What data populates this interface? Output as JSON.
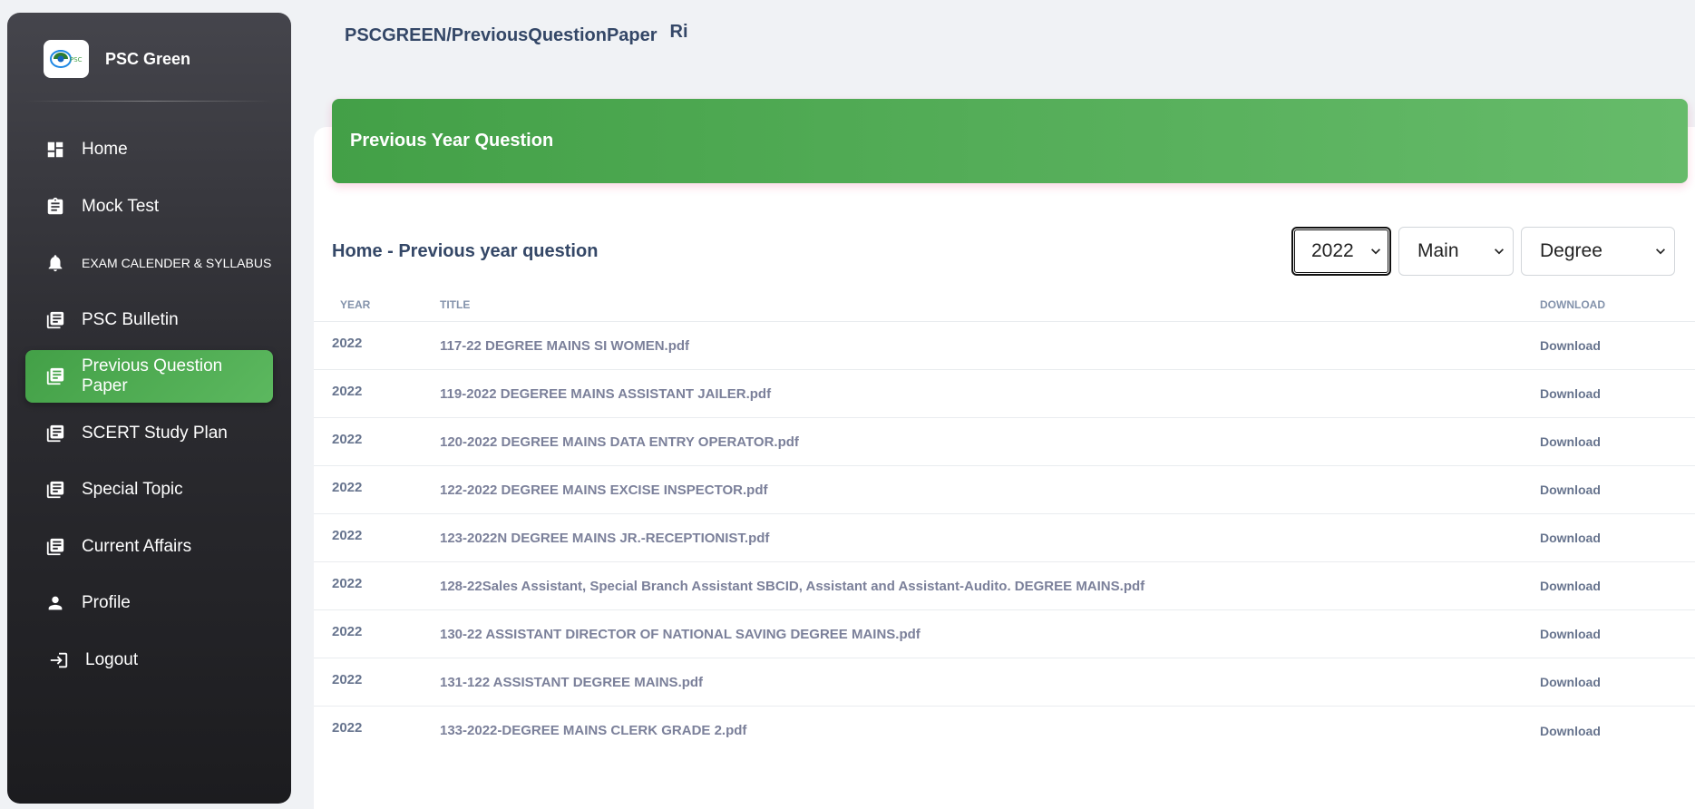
{
  "sidebar": {
    "brand_name": "PSC Green",
    "logo_text": "PSC",
    "items": [
      {
        "label": "Home",
        "icon": "dashboard-icon",
        "active": false
      },
      {
        "label": "Mock Test",
        "icon": "clipboard-icon",
        "active": false
      },
      {
        "label": "EXAM CALENDER & SYLLABUS",
        "icon": "bell-icon",
        "active": false
      },
      {
        "label": "PSC Bulletin",
        "icon": "library-icon",
        "active": false
      },
      {
        "label": "Previous Question Paper",
        "icon": "library-icon",
        "active": true
      },
      {
        "label": "SCERT Study Plan",
        "icon": "library-icon",
        "active": false
      },
      {
        "label": "Special Topic",
        "icon": "library-icon",
        "active": false
      },
      {
        "label": "Current Affairs",
        "icon": "library-icon",
        "active": false
      },
      {
        "label": "Profile",
        "icon": "person-icon",
        "active": false
      },
      {
        "label": "Logout",
        "icon": "login-icon",
        "active": false
      }
    ]
  },
  "header": {
    "breadcrumb": "PSCGREEN/PreviousQuestionPaper",
    "user_initials": "Ri"
  },
  "banner": {
    "title": "Previous Year Question"
  },
  "main": {
    "section_title": "Home - Previous year question",
    "filters": {
      "year": "2022",
      "exam_type": "Main",
      "qualification": "Degree"
    },
    "table": {
      "headers": {
        "year": "YEAR",
        "title": "TITLE",
        "download": "DOWNLOAD"
      },
      "rows": [
        {
          "year": "2022",
          "title": "117-22 DEGREE MAINS SI WOMEN.pdf",
          "action": "Download"
        },
        {
          "year": "2022",
          "title": "119-2022 DEGEREE MAINS ASSISTANT JAILER.pdf",
          "action": "Download"
        },
        {
          "year": "2022",
          "title": "120-2022 DEGREE MAINS DATA ENTRY OPERATOR.pdf",
          "action": "Download"
        },
        {
          "year": "2022",
          "title": "122-2022 DEGREE MAINS EXCISE INSPECTOR.pdf",
          "action": "Download"
        },
        {
          "year": "2022",
          "title": "123-2022N DEGREE MAINS JR.-RECEPTIONIST.pdf",
          "action": "Download"
        },
        {
          "year": "2022",
          "title": "128-22Sales Assistant, Special Branch Assistant SBCID, Assistant and Assistant-Audito. DEGREE MAINS.pdf",
          "action": "Download"
        },
        {
          "year": "2022",
          "title": "130-22 ASSISTANT DIRECTOR OF NATIONAL SAVING DEGREE MAINS.pdf",
          "action": "Download"
        },
        {
          "year": "2022",
          "title": "131-122 ASSISTANT DEGREE MAINS.pdf",
          "action": "Download"
        },
        {
          "year": "2022",
          "title": "133-2022-DEGREE MAINS CLERK GRADE 2.pdf",
          "action": "Download"
        }
      ]
    }
  },
  "colors": {
    "accent_green": "#4caf50",
    "sidebar_dark": "#2c2c31",
    "heading": "#344767"
  }
}
